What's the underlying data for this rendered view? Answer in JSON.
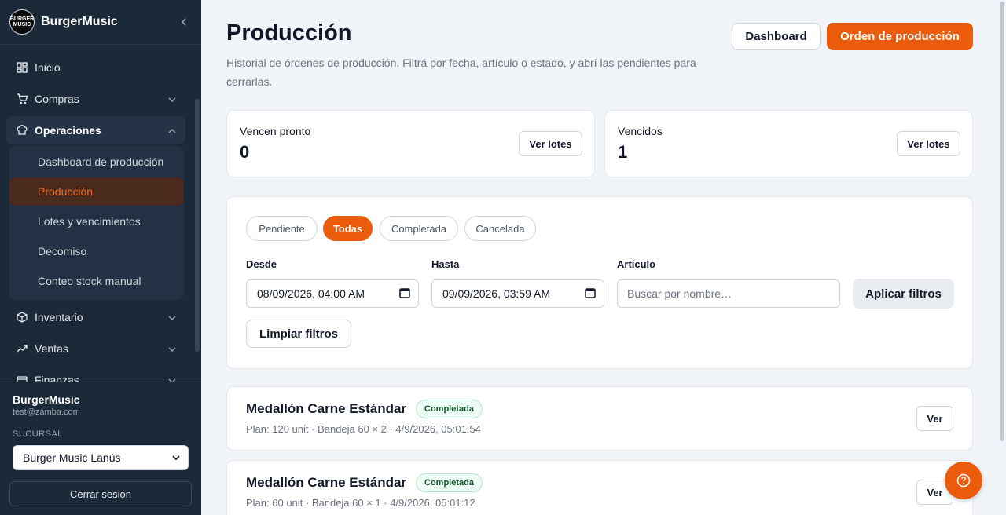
{
  "sidebar": {
    "brand": "BurgerMusic",
    "logo_text": "BURGER MUSIC",
    "nav": [
      {
        "label": "Inicio",
        "icon": "dashboard-grid-icon"
      },
      {
        "label": "Compras",
        "icon": "cart-icon"
      },
      {
        "label": "Operaciones",
        "icon": "chef-hat-icon"
      },
      {
        "label": "Inventario",
        "icon": "box-icon"
      },
      {
        "label": "Ventas",
        "icon": "trend-up-icon"
      },
      {
        "label": "Finanzas",
        "icon": "wallet-icon"
      }
    ],
    "submenu": [
      {
        "label": "Dashboard de producción"
      },
      {
        "label": "Producción",
        "active": true
      },
      {
        "label": "Lotes y vencimientos"
      },
      {
        "label": "Decomiso"
      },
      {
        "label": "Conteo stock manual"
      }
    ],
    "footer": {
      "user": "BurgerMusic",
      "email": "test@zamba.com",
      "branch_label": "SUCURSAL",
      "branch": "Burger Music Lanús",
      "logout": "Cerrar sesión"
    }
  },
  "header": {
    "title": "Producción",
    "description": "Historial de órdenes de producción. Filtrá por fecha, artículo o estado, y abrí las pendientes para cerrarlas.",
    "dashboard_btn": "Dashboard",
    "new_order_btn": "Orden de producción"
  },
  "stats": [
    {
      "label": "Vencen pronto",
      "value": "0",
      "action": "Ver lotes"
    },
    {
      "label": "Vencidos",
      "value": "1",
      "action": "Ver lotes"
    }
  ],
  "filters": {
    "status_chips": [
      {
        "label": "Pendiente"
      },
      {
        "label": "Todas",
        "active": true
      },
      {
        "label": "Completada"
      },
      {
        "label": "Cancelada"
      }
    ],
    "from_label": "Desde",
    "from_value": "08/09/2026, 04:00 AM",
    "to_label": "Hasta",
    "to_value": "09/09/2026, 03:59 AM",
    "article_label": "Artículo",
    "article_placeholder": "Buscar por nombre…",
    "apply_btn": "Aplicar filtros",
    "clear_btn": "Limpiar filtros"
  },
  "orders": [
    {
      "title": "Medallón Carne Estándar",
      "status": "Completada",
      "meta": "Plan: 120 unit · Bandeja 60 × 2 · 4/9/2026, 05:01:54",
      "action": "Ver"
    },
    {
      "title": "Medallón Carne Estándar",
      "status": "Completada",
      "meta": "Plan: 60 unit · Bandeja 60 × 1 · 4/9/2026, 05:01:12",
      "action": "Ver"
    }
  ],
  "colors": {
    "accent": "#ea5b0c",
    "sidebar_bg": "#1c2938",
    "page_bg": "#f1f4f8"
  }
}
